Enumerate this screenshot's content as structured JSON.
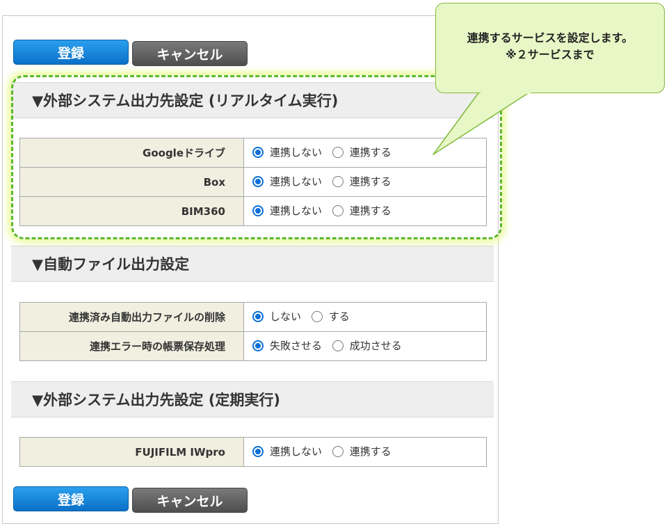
{
  "buttons": {
    "register_label": "登録",
    "cancel_label": "キャンセル"
  },
  "sections": [
    {
      "title": "▼外部システム出力先設定 (リアルタイム実行)",
      "rows": [
        {
          "label": "Googleドライブ",
          "options": [
            "連携しない",
            "連携する"
          ],
          "selected": 0
        },
        {
          "label": "Box",
          "options": [
            "連携しない",
            "連携する"
          ],
          "selected": 0
        },
        {
          "label": "BIM360",
          "options": [
            "連携しない",
            "連携する"
          ],
          "selected": 0
        }
      ]
    },
    {
      "title": "▼自動ファイル出力設定",
      "rows": [
        {
          "label": "連携済み自動出力ファイルの削除",
          "options": [
            "しない",
            "する"
          ],
          "selected": 0
        },
        {
          "label": "連携エラー時の帳票保存処理",
          "options": [
            "失敗させる",
            "成功させる"
          ],
          "selected": 0
        }
      ]
    },
    {
      "title": "▼外部システム出力先設定 (定期実行)",
      "rows": [
        {
          "label": "FUJIFILM IWpro",
          "options": [
            "連携しない",
            "連携する"
          ],
          "selected": 0
        }
      ]
    }
  ],
  "callout": {
    "line1": "連携するサービスを設定します。",
    "line2": "※２サービスまで"
  },
  "colors": {
    "primary_button": "#0a70c8",
    "secondary_button": "#555555",
    "radio_selected": "#0a70d8",
    "label_cell_bg": "#f0efe0",
    "highlight_border": "#5cb82a",
    "callout_bg": "#e8f7c6"
  }
}
